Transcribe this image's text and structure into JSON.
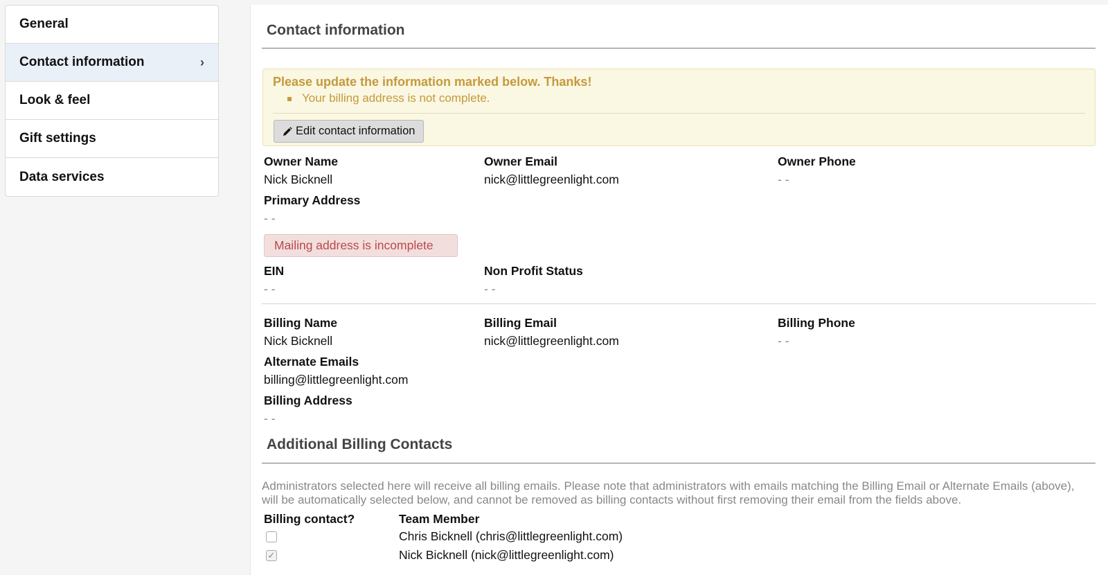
{
  "sidebar": {
    "items": [
      {
        "label": "General"
      },
      {
        "label": "Contact information"
      },
      {
        "label": "Look & feel"
      },
      {
        "label": "Gift settings"
      },
      {
        "label": "Data services"
      }
    ]
  },
  "main": {
    "title": "Contact information",
    "alert": {
      "title": "Please update the information marked below. Thanks!",
      "items": [
        "Your billing address is not complete."
      ],
      "edit_button": "Edit contact information"
    },
    "owner": {
      "name_label": "Owner Name",
      "name": "Nick Bicknell",
      "email_label": "Owner Email",
      "email": "nick@littlegreenlight.com",
      "phone_label": "Owner Phone",
      "phone": "- -"
    },
    "primary_address": {
      "label": "Primary Address",
      "value": "- -",
      "error": "Mailing address is incomplete"
    },
    "ein": {
      "label": "EIN",
      "value": "- -"
    },
    "nonprofit": {
      "label": "Non Profit Status",
      "value": "- -"
    },
    "billing": {
      "name_label": "Billing Name",
      "name": "Nick Bicknell",
      "email_label": "Billing Email",
      "email": "nick@littlegreenlight.com",
      "phone_label": "Billing Phone",
      "phone": "- -",
      "alt_emails_label": "Alternate Emails",
      "alt_emails": "billing@littlegreenlight.com",
      "address_label": "Billing Address",
      "address": "- -"
    },
    "additional": {
      "title": "Additional Billing Contacts",
      "description": "Administrators selected here will receive all billing emails. Please note that administrators with emails matching the Billing Email or Alternate Emails (above), will be automatically selected below, and cannot be removed as billing contacts without first removing their email from the fields above.",
      "col_billing": "Billing contact?",
      "col_member": "Team Member",
      "rows": [
        {
          "member": "Chris Bicknell (chris@littlegreenlight.com)",
          "checked": false
        },
        {
          "member": "Nick Bicknell (nick@littlegreenlight.com)",
          "checked": true
        }
      ]
    }
  }
}
